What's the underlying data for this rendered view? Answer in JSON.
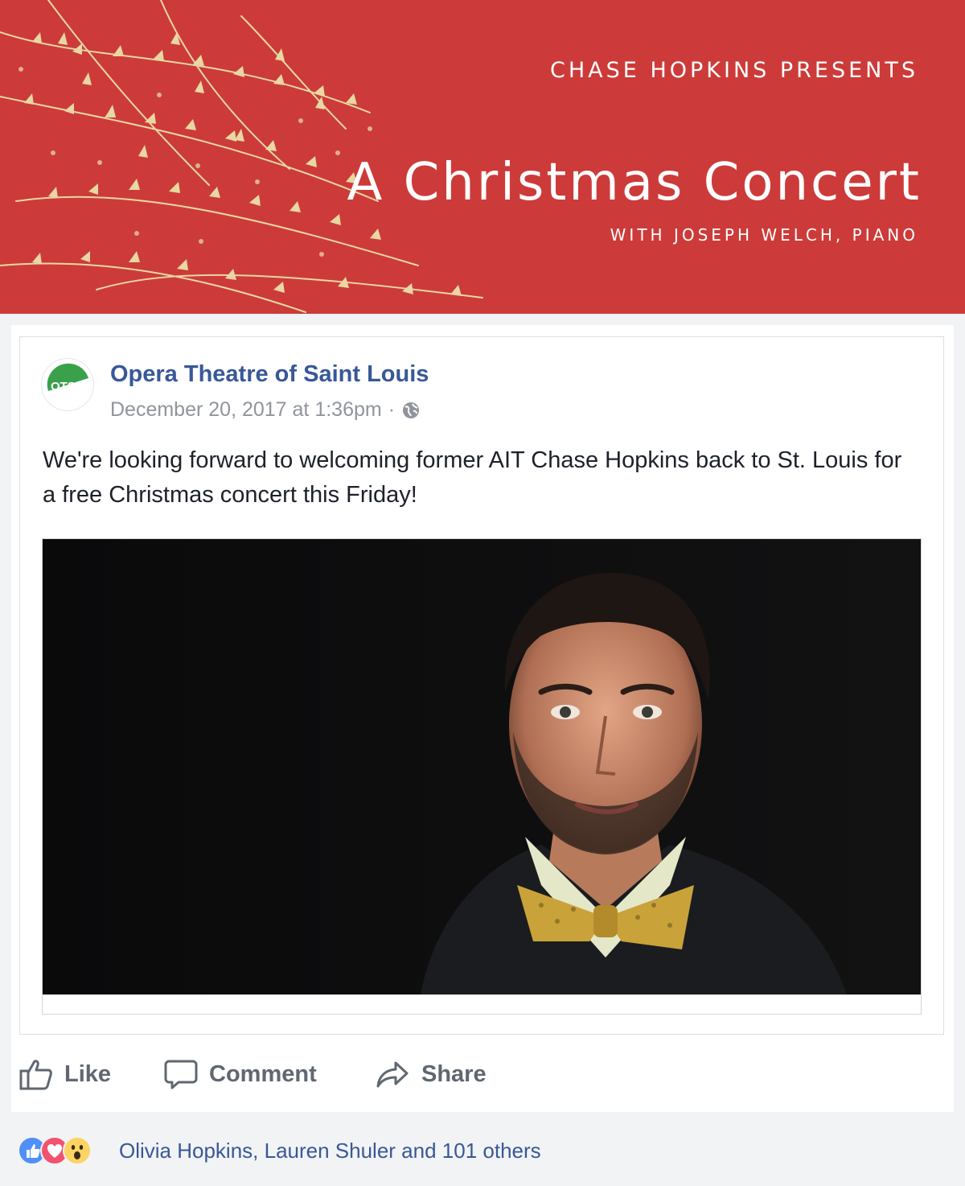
{
  "banner": {
    "eyebrow": "CHASE HOPKINS PRESENTS",
    "title": "A Christmas Concert",
    "subtitle": "WITH JOSEPH WELCH, PIANO",
    "background_color": "#cc3b39",
    "branch_color": "#e9d7a2"
  },
  "post": {
    "page_name": "Opera Theatre of Saint Louis",
    "avatar_initials": "OTSL",
    "timestamp": "December 20, 2017 at 1:36pm",
    "separator": "·",
    "privacy_icon": "globe-icon",
    "text": "We're looking forward to welcoming former AIT Chase Hopkins back to St. Louis for a free Christmas concert this Friday!",
    "accent_color": "#385898"
  },
  "actions": {
    "like_label": "Like",
    "comment_label": "Comment",
    "share_label": "Share",
    "icons": [
      "thumbs-up-icon",
      "comment-bubble-icon",
      "share-arrow-icon"
    ]
  },
  "reactions": {
    "types": [
      "like",
      "love",
      "wow"
    ],
    "summary": "Olivia Hopkins, Lauren Shuler and 101 others"
  }
}
